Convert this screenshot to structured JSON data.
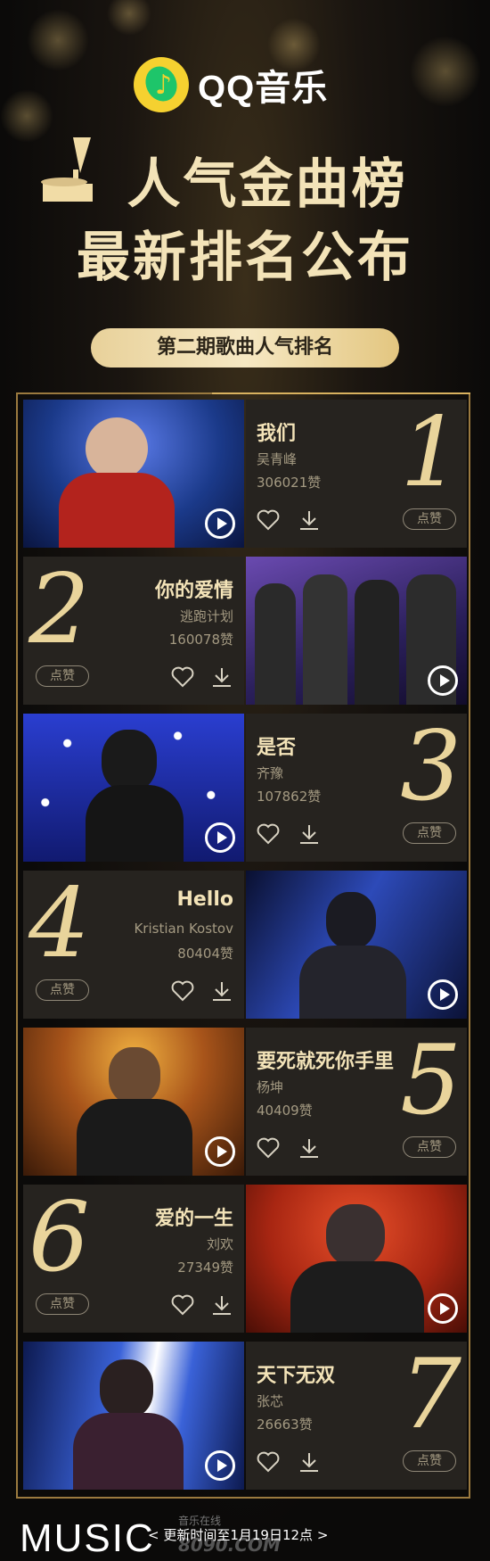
{
  "brand": {
    "name": "QQ音乐"
  },
  "header": {
    "title_line1": "人气金曲榜",
    "title_line2": "最新排名公布",
    "period_label": "第二期歌曲人气排名"
  },
  "ranking": [
    {
      "rank": "1",
      "song": "我们",
      "artist": "吴青峰",
      "likes": "306021赞",
      "like_button": "点赞",
      "photo_bg": "#1b3a8a"
    },
    {
      "rank": "2",
      "song": "你的爱情",
      "artist": "逃跑计划",
      "likes": "160078赞",
      "like_button": "点赞",
      "photo_bg": "#3a2b6e"
    },
    {
      "rank": "3",
      "song": "是否",
      "artist": "齐豫",
      "likes": "107862赞",
      "like_button": "点赞",
      "photo_bg": "#1a2a7a"
    },
    {
      "rank": "4",
      "song": "Hello",
      "artist": "Kristian Kostov",
      "likes": "80404赞",
      "like_button": "点赞",
      "photo_bg": "#13205a"
    },
    {
      "rank": "5",
      "song": "要死就死你手里",
      "artist": "杨坤",
      "likes": "40409赞",
      "like_button": "点赞",
      "photo_bg": "#7a3a10"
    },
    {
      "rank": "6",
      "song": "爱的一生",
      "artist": "刘欢",
      "likes": "27349赞",
      "like_button": "点赞",
      "photo_bg": "#9a2412"
    },
    {
      "rank": "7",
      "song": "天下无双",
      "artist": "张芯",
      "likes": "26663赞",
      "like_button": "点赞",
      "photo_bg": "#1d3c8c"
    }
  ],
  "footer": {
    "music_word": "MUSIC",
    "update_text": "< 更新时间至1月19日12点 >",
    "watermark_top": "音乐在线",
    "watermark_main": "8090.COM"
  },
  "colors": {
    "gold": "#e9d49b",
    "panel": "#26231f",
    "frame": "#9b7a3f"
  }
}
